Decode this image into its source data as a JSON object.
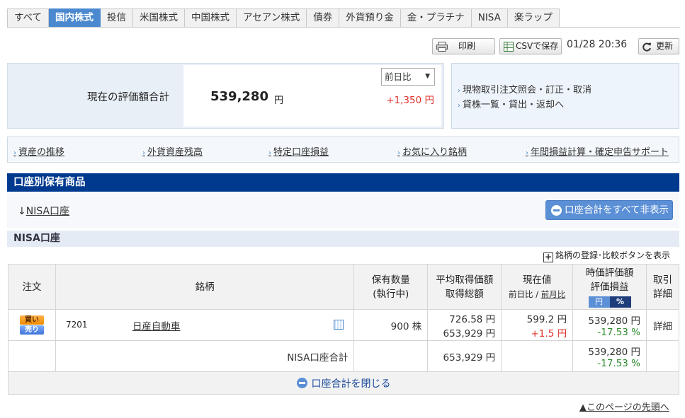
{
  "tabs": [
    "すべて",
    "国内株式",
    "投信",
    "米国株式",
    "中国株式",
    "アセアン株式",
    "債券",
    "外貨預り金",
    "金・プラチナ",
    "NISA",
    "楽ラップ"
  ],
  "active_tab_index": 1,
  "toolbar": {
    "print_label": "印刷",
    "csv_label": "CSVで保存",
    "timestamp": "01/28 20:36",
    "refresh_label": "更新"
  },
  "summary": {
    "label": "現在の評価額合計",
    "value": "539,280",
    "unit": "円",
    "compare_select": "前日比",
    "change": "+1,350 円"
  },
  "side_links": [
    "現物取引注文照会・訂正・取消",
    "貸株一覧・貸出・返却へ"
  ],
  "nav_links": [
    "資産の推移",
    "外貨資産残高",
    "特定口座損益",
    "お気に入り銘柄",
    "年間損益計算・確定申告サポート"
  ],
  "section": {
    "title": "口座別保有商品",
    "account_link": "NISA口座",
    "account_link_prefix": "↓",
    "hide_all_button": "口座合計をすべて非表示",
    "nisa_heading": "NISA口座",
    "register_note": "銘柄の登録･比較ボタンを表示"
  },
  "table": {
    "headers": {
      "order": "注文",
      "name": "銘柄",
      "qty_1": "保有数量",
      "qty_2": "(執行中)",
      "avg_1": "平均取得価額",
      "avg_2": "取得総額",
      "current_1": "現在値",
      "current_sub_a": "前日比",
      "current_sub_sep": "/",
      "current_sub_b": "前月比",
      "value_1": "時価評価額",
      "value_2": "評価損益",
      "toggle_yen": "円",
      "toggle_pct": "%",
      "detail_1": "取引",
      "detail_2": "詳細"
    },
    "row": {
      "buy": "買い",
      "sell": "売り",
      "code": "7201",
      "name": "日産自動車",
      "qty": "900 株",
      "avg_price": "726.58 円",
      "total_cost": "653,929 円",
      "current_price": "599.2 円",
      "day_change": "+1.5 円",
      "market_value": "539,280 円",
      "pl_pct": "-17.53 %",
      "detail": "詳細"
    },
    "subtotal": {
      "label": "NISA口座合計",
      "total_cost": "653,929 円",
      "market_value": "539,280 円",
      "pl_pct": "-17.53 %"
    },
    "close_label": "口座合計を閉じる"
  },
  "page_top": "▲このページの先頭へ"
}
